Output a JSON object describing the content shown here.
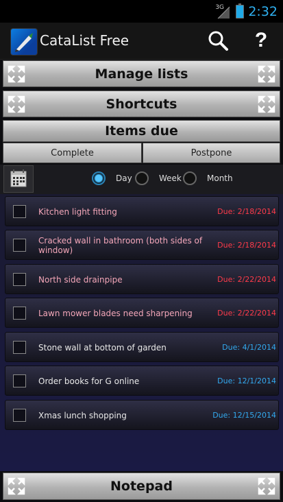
{
  "status_bar": {
    "network": "3G",
    "time": "2:32"
  },
  "action_bar": {
    "title": "CataList Free",
    "help_label": "?"
  },
  "sections": {
    "manage_lists": "Manage lists",
    "shortcuts": "Shortcuts",
    "items_due": "Items due",
    "notepad": "Notepad"
  },
  "buttons": {
    "complete": "Complete",
    "postpone": "Postpone"
  },
  "filters": {
    "options": [
      "Day",
      "Week",
      "Month"
    ],
    "selected": "Day"
  },
  "items": [
    {
      "text": "Kitchen light fitting",
      "due": "Due: 2/18/2014",
      "status": "overdue"
    },
    {
      "text": "Cracked wall in bathroom (both sides of window)",
      "due": "Due: 2/18/2014",
      "status": "overdue"
    },
    {
      "text": "North side drainpipe",
      "due": "Due: 2/22/2014",
      "status": "overdue"
    },
    {
      "text": "Lawn mower blades need sharpening",
      "due": "Due: 2/22/2014",
      "status": "overdue"
    },
    {
      "text": "Stone wall at bottom of garden",
      "due": "Due: 4/1/2014",
      "status": "upcoming"
    },
    {
      "text": "Order books for G online",
      "due": "Due: 12/1/2014",
      "status": "upcoming"
    },
    {
      "text": "Xmas lunch shopping",
      "due": "Due: 12/15/2014",
      "status": "upcoming"
    }
  ],
  "colors": {
    "overdue_text": "#f3a6b8",
    "overdue_due": "#ff3b4a",
    "upcoming_due": "#33aaf0",
    "clock": "#2fb0f0"
  }
}
